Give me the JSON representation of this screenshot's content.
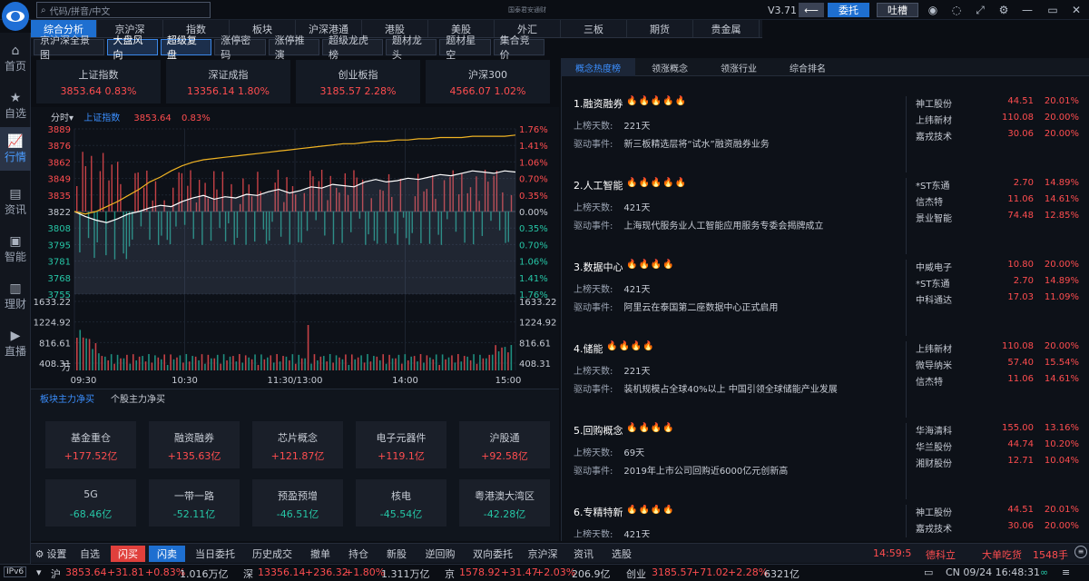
{
  "app": {
    "version": "V3.71",
    "brand_title": "国泰君安通财",
    "search_placeholder": "代码/拼音/中文"
  },
  "titlebar": {
    "entrust_label": "委托",
    "feedback_label": "吐槽"
  },
  "colors": {
    "up": "#ff4d4f",
    "down": "#26c6a6",
    "accent": "#1e6fd0",
    "price_line": "#ffffff",
    "avg_line": "#f0b323"
  },
  "sidebar": {
    "items": [
      {
        "label": "首页",
        "icon": "home-icon"
      },
      {
        "label": "自选",
        "icon": "star-icon"
      },
      {
        "label": "行情",
        "icon": "chart-icon",
        "active": true
      },
      {
        "label": "资讯",
        "icon": "news-icon"
      },
      {
        "label": "智能",
        "icon": "robot-icon"
      },
      {
        "label": "理财",
        "icon": "wallet-icon"
      },
      {
        "label": "直播",
        "icon": "tv-icon"
      }
    ]
  },
  "top_tabs": [
    "综合分析",
    "京沪深",
    "指数",
    "板块",
    "沪深港通",
    "港股",
    "美股",
    "外汇",
    "三板",
    "期货",
    "贵金属"
  ],
  "sub_tabs": [
    "京沪深全景图",
    "大盘风向",
    "超级复盘",
    "涨停密码",
    "涨停推演",
    "超级龙虎榜",
    "题材龙头",
    "题材星空",
    "集合竞价"
  ],
  "index_cards": [
    {
      "name": "上证指数",
      "value": "3853.64  0.83%"
    },
    {
      "name": "深证成指",
      "value": "13356.14  1.80%"
    },
    {
      "name": "创业板指",
      "value": "3185.57  2.28%"
    },
    {
      "name": "沪深300",
      "value": "4566.07  1.02%"
    }
  ],
  "chart_header": {
    "period": "分时▾",
    "index_name": "上证指数",
    "price": "3853.64",
    "pct": "0.83%"
  },
  "chart_data": {
    "type": "line",
    "title": "上证指数 分时",
    "x_ticks": [
      "09:30",
      "10:30",
      "11:30/13:00",
      "14:00",
      "15:00"
    ],
    "y_price_ticks": [
      "3889",
      "3876",
      "3862",
      "3849",
      "3835",
      "3822",
      "3808",
      "3795",
      "3781",
      "3768",
      "3755"
    ],
    "y_pct_ticks": [
      "1.76%",
      "1.41%",
      "1.06%",
      "0.70%",
      "0.35%",
      "0.00%",
      "0.35%",
      "0.70%",
      "1.06%",
      "1.41%",
      "1.76%"
    ],
    "ylim": [
      3755,
      3889
    ],
    "prev_close": 3822,
    "volume_ticks": [
      "1633.22",
      "1224.92",
      "816.61",
      "408.31",
      "万"
    ],
    "series": [
      {
        "name": "价格",
        "values": [
          3822,
          3818,
          3815,
          3813,
          3816,
          3820,
          3822,
          3825,
          3827,
          3826,
          3830,
          3833,
          3835,
          3832,
          3834,
          3833,
          3836,
          3835,
          3838,
          3840,
          3837,
          3839,
          3842,
          3841,
          3844,
          3843,
          3842,
          3846,
          3848,
          3846,
          3847,
          3849,
          3848,
          3850,
          3852,
          3851,
          3853,
          3855,
          3854,
          3853,
          3855,
          3854
        ]
      },
      {
        "name": "均价",
        "values": [
          3822,
          3820,
          3822,
          3826,
          3830,
          3835,
          3840,
          3846,
          3850,
          3855,
          3859,
          3862,
          3864,
          3865,
          3866,
          3867,
          3868,
          3869,
          3870,
          3871,
          3872,
          3873,
          3874,
          3875,
          3876,
          3877,
          3877,
          3878,
          3879,
          3879,
          3880,
          3880,
          3881,
          3881,
          3882,
          3882,
          3882,
          3883,
          3883,
          3883,
          3883,
          3884
        ]
      }
    ],
    "grid": true
  },
  "flow_tabs": [
    "板块主力净买",
    "个股主力净买"
  ],
  "flow_cards": [
    {
      "name": "基金重仓",
      "value": "+177.52亿",
      "dir": "up"
    },
    {
      "name": "融资融券",
      "value": "+135.63亿",
      "dir": "up"
    },
    {
      "name": "芯片概念",
      "value": "+121.87亿",
      "dir": "up"
    },
    {
      "name": "电子元器件",
      "value": "+119.1亿",
      "dir": "up"
    },
    {
      "name": "沪股通",
      "value": "+92.58亿",
      "dir": "up"
    },
    {
      "name": "5G",
      "value": "-68.46亿",
      "dir": "down"
    },
    {
      "name": "一带一路",
      "value": "-52.11亿",
      "dir": "down"
    },
    {
      "name": "预盈预增",
      "value": "-46.51亿",
      "dir": "down"
    },
    {
      "name": "核电",
      "value": "-45.54亿",
      "dir": "down"
    },
    {
      "name": "粤港澳大湾区",
      "value": "-42.28亿",
      "dir": "down"
    }
  ],
  "right_tabs": [
    "概念热度榜",
    "领涨概念",
    "领涨行业",
    "综合排名"
  ],
  "concepts": [
    {
      "title": "1.融资融券",
      "fire": "🔥🔥🔥🔥🔥",
      "days_label": "上榜天数:",
      "days": "221天",
      "event_label": "驱动事件:",
      "event": "新三板精选层将“试水”融资融券业务",
      "stocks": [
        {
          "n": "神工股份",
          "p": "44.51",
          "c": "20.01%"
        },
        {
          "n": "上纬新材",
          "p": "110.08",
          "c": "20.00%"
        },
        {
          "n": "嘉戎技术",
          "p": "30.06",
          "c": "20.00%"
        }
      ]
    },
    {
      "title": "2.人工智能",
      "fire": "🔥🔥🔥🔥🔥",
      "days_label": "上榜天数:",
      "days": "421天",
      "event_label": "驱动事件:",
      "event": "上海现代服务业人工智能应用服务专委会揭牌成立",
      "stocks": [
        {
          "n": "*ST东通",
          "p": "2.70",
          "c": "14.89%"
        },
        {
          "n": "信杰特",
          "p": "11.06",
          "c": "14.61%"
        },
        {
          "n": "景业智能",
          "p": "74.48",
          "c": "12.85%"
        }
      ]
    },
    {
      "title": "3.数据中心",
      "fire": "🔥🔥🔥🔥",
      "days_label": "上榜天数:",
      "days": "421天",
      "event_label": "驱动事件:",
      "event": "阿里云在泰国第二座数据中心正式启用",
      "stocks": [
        {
          "n": "中威电子",
          "p": "10.80",
          "c": "20.00%"
        },
        {
          "n": "*ST东通",
          "p": "2.70",
          "c": "14.89%"
        },
        {
          "n": "中科通达",
          "p": "17.03",
          "c": "11.09%"
        }
      ]
    },
    {
      "title": "4.储能",
      "fire": "🔥🔥🔥🔥",
      "days_label": "上榜天数:",
      "days": "221天",
      "event_label": "驱动事件:",
      "event": "装机规模占全球40%以上 中国引领全球储能产业发展",
      "stocks": [
        {
          "n": "上纬新材",
          "p": "110.08",
          "c": "20.00%"
        },
        {
          "n": "微导纳米",
          "p": "57.40",
          "c": "15.54%"
        },
        {
          "n": "信杰特",
          "p": "11.06",
          "c": "14.61%"
        }
      ]
    },
    {
      "title": "5.回购概念",
      "fire": "🔥🔥🔥🔥",
      "days_label": "上榜天数:",
      "days": "69天",
      "event_label": "驱动事件:",
      "event": "2019年上市公司回购近6000亿元创新高",
      "stocks": [
        {
          "n": "华海清科",
          "p": "155.00",
          "c": "13.16%"
        },
        {
          "n": "华兰股份",
          "p": "44.74",
          "c": "10.20%"
        },
        {
          "n": "湘财股份",
          "p": "12.71",
          "c": "10.04%"
        }
      ]
    },
    {
      "title": "6.专精特新",
      "fire": "🔥🔥🔥🔥",
      "days_label": "上榜天数:",
      "days": "421天",
      "event_label": "",
      "event": "",
      "stocks": [
        {
          "n": "神工股份",
          "p": "44.51",
          "c": "20.01%"
        },
        {
          "n": "嘉戎技术",
          "p": "30.06",
          "c": "20.00%"
        }
      ]
    }
  ],
  "bottom_bar": {
    "buttons": [
      "设置",
      "自选",
      "闪买",
      "闪卖",
      "当日委托",
      "历史成交",
      "撤单",
      "持仓",
      "新股",
      "逆回购",
      "双向委托",
      "京沪深",
      "资讯",
      "选股"
    ],
    "time": "14:59:5",
    "stock": "德科立",
    "event": "大单吃货",
    "volume": "1548手"
  },
  "status_bar": {
    "ipv6": "IPv6",
    "sh_label": "沪",
    "sh_price": "3853.64",
    "sh_chg": "+31.81",
    "sh_pct": "+0.83%",
    "sh_amt": "1.016万亿",
    "sz_label": "深",
    "sz_price": "13356.14",
    "sz_chg": "+236.32",
    "sz_pct": "+1.80%",
    "sz_amt": "1.311万亿",
    "bj_label": "京",
    "bj_price": "1578.92",
    "bj_chg": "+31.47",
    "bj_pct": "+2.03%",
    "bj_amt": "206.9亿",
    "cy_label": "创业",
    "cy_price": "3185.57",
    "cy_chg": "+71.02",
    "cy_pct": "+2.28%",
    "cy_amt": "6321亿",
    "datetime": "CN 09/24 16:48:31"
  }
}
